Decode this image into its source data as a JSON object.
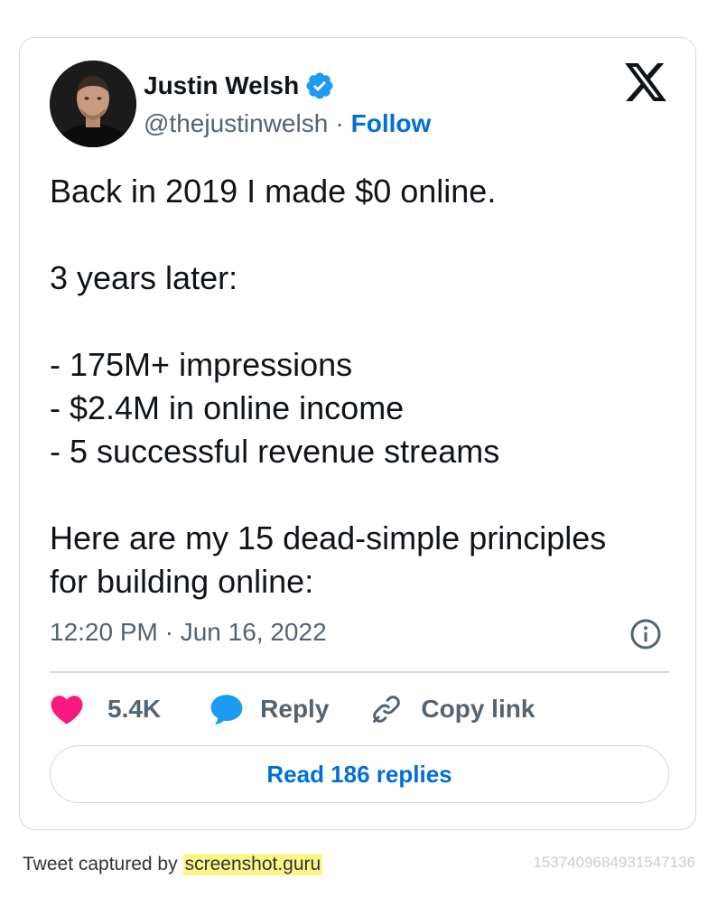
{
  "author": {
    "name": "Justin Welsh",
    "handle": "@thejustinwelsh",
    "separator": "·",
    "follow_label": "Follow"
  },
  "tweet": {
    "lines": [
      "Back in 2019 I made $0 online.",
      "",
      "3 years later:",
      "",
      "- 175M+ impressions",
      "- $2.4M in online income",
      "- 5 successful revenue streams",
      "",
      "Here are my 15 dead-simple principles",
      "for building online:"
    ],
    "timestamp": "12:20 PM · Jun 16, 2022"
  },
  "actions": {
    "likes_count": "5.4K",
    "reply_label": "Reply",
    "copy_link_label": "Copy link"
  },
  "read_replies_label": "Read 186 replies",
  "footer": {
    "captured_by": "Tweet captured by",
    "brand": "screenshot.guru",
    "tweet_id": "1537409684931547136"
  },
  "colors": {
    "accent_blue": "#006fd6",
    "verified_blue": "#1d9bf0",
    "like_pink": "#f91880",
    "reply_blue": "#1d9bf0",
    "muted_text": "#536471",
    "border": "#cfd9de",
    "highlight": "#fbf68a"
  },
  "icons": {
    "verified": "verified-badge-icon",
    "logo": "x-logo-icon",
    "info": "info-icon",
    "like": "heart-icon",
    "reply": "speech-bubble-icon",
    "copy": "link-icon"
  }
}
